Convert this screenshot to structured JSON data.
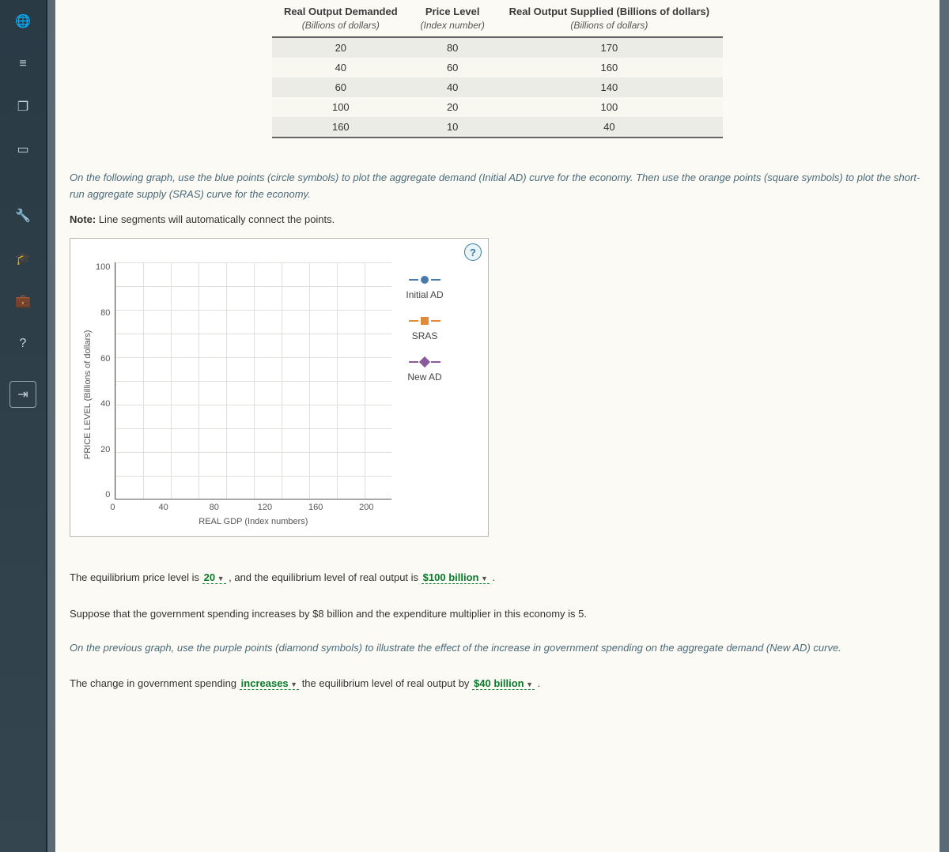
{
  "sidebar": {
    "icons": [
      {
        "name": "globe-icon",
        "glyph": "🌐"
      },
      {
        "name": "list-icon",
        "glyph": "≡"
      },
      {
        "name": "copy-icon",
        "glyph": "❐"
      },
      {
        "name": "card-icon",
        "glyph": "▭"
      },
      {
        "name": "wrench-icon",
        "glyph": "🔧"
      },
      {
        "name": "grad-cap-icon",
        "glyph": "🎓"
      },
      {
        "name": "briefcase-icon",
        "glyph": "💼"
      },
      {
        "name": "help-icon",
        "glyph": "?"
      }
    ],
    "exit_glyph": "⇥"
  },
  "table": {
    "headers": [
      {
        "title": "Real Output Demanded",
        "sub": "(Billions of dollars)"
      },
      {
        "title": "Price Level",
        "sub": "(Index number)"
      },
      {
        "title": "Real Output Supplied (Billions of dollars)",
        "sub": "(Billions of dollars)"
      }
    ],
    "rows": [
      {
        "c1": "20",
        "c2": "80",
        "c3": "170"
      },
      {
        "c1": "40",
        "c2": "60",
        "c3": "160"
      },
      {
        "c1": "60",
        "c2": "40",
        "c3": "140"
      },
      {
        "c1": "100",
        "c2": "20",
        "c3": "100"
      },
      {
        "c1": "160",
        "c2": "10",
        "c3": "40"
      }
    ]
  },
  "instructions": {
    "p1": "On the following graph, use the blue points (circle symbols) to plot the aggregate demand (Initial AD) curve for the economy. Then use the orange points (square symbols) to plot the short-run aggregate supply (SRAS) curve for the economy.",
    "note_label": "Note:",
    "note_text": " Line segments will automatically connect the points."
  },
  "chart_data": {
    "type": "line",
    "title": "",
    "xlabel": "REAL GDP (Index numbers)",
    "ylabel": "PRICE LEVEL (Billions of dollars)",
    "xlim": [
      0,
      200
    ],
    "ylim": [
      0,
      100
    ],
    "x_ticks": [
      "0",
      "40",
      "80",
      "120",
      "160",
      "200"
    ],
    "y_ticks": [
      "100",
      "80",
      "60",
      "40",
      "20",
      "0"
    ],
    "series": [
      {
        "name": "Initial AD",
        "symbol": "circle",
        "color": "#4a7aaa",
        "points": []
      },
      {
        "name": "SRAS",
        "symbol": "square",
        "color": "#e08a3a",
        "points": []
      },
      {
        "name": "New AD",
        "symbol": "diamond",
        "color": "#8a5a9a",
        "points": []
      }
    ],
    "help_glyph": "?"
  },
  "answers": {
    "eq_text_1": "The equilibrium price level is ",
    "eq_drop_1": "20",
    "eq_text_2": " , and the equilibrium level of real output is ",
    "eq_drop_2": "$100 billion",
    "eq_text_3": " .",
    "suppose": "Suppose that the government spending increases by $8 billion and the expenditure multiplier in this economy is 5.",
    "instr2": "On the previous graph, use the purple points (diamond symbols) to illustrate the effect of the increase in government spending on the aggregate demand (New AD) curve.",
    "change_1": "The change in government spending ",
    "change_drop_1": "increases",
    "change_2": " the equilibrium level of real output by ",
    "change_drop_2": "$40 billion",
    "change_3": " ."
  }
}
